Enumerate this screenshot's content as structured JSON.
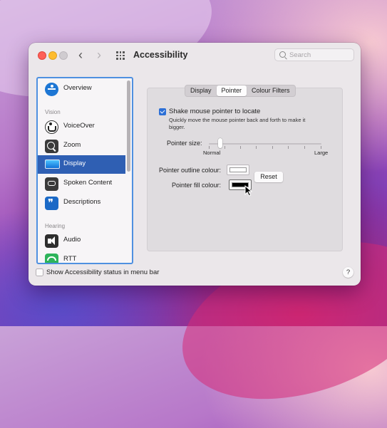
{
  "window": {
    "title": "Accessibility",
    "nav_back": "‹",
    "nav_forward": "›"
  },
  "search": {
    "placeholder": "Search",
    "value": ""
  },
  "sidebar": {
    "items": [
      {
        "label": "Overview",
        "icon": "overview-icon"
      },
      {
        "header": "Vision"
      },
      {
        "label": "VoiceOver",
        "icon": "voiceover-icon"
      },
      {
        "label": "Zoom",
        "icon": "zoom-icon"
      },
      {
        "label": "Display",
        "icon": "display-icon",
        "selected": true
      },
      {
        "label": "Spoken Content",
        "icon": "spoken-content-icon"
      },
      {
        "label": "Descriptions",
        "icon": "descriptions-icon"
      },
      {
        "header": "Hearing"
      },
      {
        "label": "Audio",
        "icon": "audio-icon"
      },
      {
        "label": "RTT",
        "icon": "rtt-icon"
      }
    ]
  },
  "tabs": [
    {
      "label": "Display",
      "active": false
    },
    {
      "label": "Pointer",
      "active": true
    },
    {
      "label": "Colour Filters",
      "active": false
    }
  ],
  "pointer": {
    "shake_label": "Shake mouse pointer to locate",
    "shake_checked": true,
    "shake_help": "Quickly move the mouse pointer back and forth to make it bigger.",
    "size_label": "Pointer size:",
    "size_min_label": "Normal",
    "size_max_label": "Large",
    "size_level": 0.1,
    "outline_label": "Pointer outline colour:",
    "outline_color": "#FFFFFF",
    "fill_label": "Pointer fill colour:",
    "fill_color": "#000000",
    "reset_label": "Reset"
  },
  "footer": {
    "status_label": "Show Accessibility status in menu bar",
    "status_checked": false,
    "help_label": "?"
  },
  "colors": {
    "accent": "#2C6FD6",
    "selection": "#2F5FB3"
  }
}
